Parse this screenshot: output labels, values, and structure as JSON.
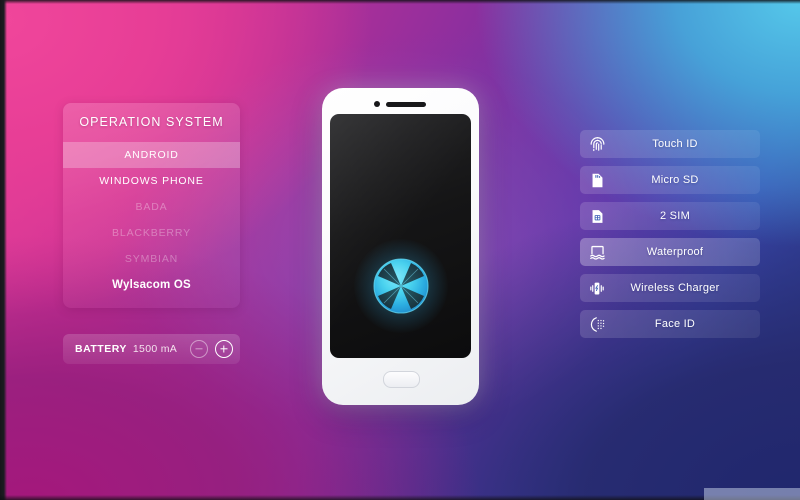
{
  "background": {
    "colors": {
      "pink": "#e8409a",
      "magenta": "#a4187c",
      "cyan": "#55c8ea",
      "navy": "#20276e",
      "purple": "#5b36a8"
    }
  },
  "os_panel": {
    "title": "OPERATION SYSTEM",
    "items": [
      {
        "label": "ANDROID",
        "state": "selected"
      },
      {
        "label": "WINDOWS PHONE",
        "state": "normal"
      },
      {
        "label": "BADA",
        "state": "disabled"
      },
      {
        "label": "BLACKBERRY",
        "state": "disabled"
      },
      {
        "label": "SYMBIAN",
        "state": "disabled"
      },
      {
        "label": "Wylsacom OS",
        "state": "brand"
      }
    ]
  },
  "battery": {
    "label": "BATTERY",
    "value": "1500 mA",
    "decrement_icon": "minus-icon",
    "increment_icon": "plus-icon"
  },
  "phone": {
    "camera_icon": "camera-dot-icon",
    "speaker_icon": "earpiece-speaker-icon",
    "home_button_icon": "home-button-icon",
    "logo_icon": "wylsacom-logo-icon",
    "logo_color": "#4fd8f0"
  },
  "features": [
    {
      "label": "Touch ID",
      "icon": "fingerprint-icon",
      "state": "normal"
    },
    {
      "label": "Micro SD",
      "icon": "sd-card-icon",
      "state": "normal"
    },
    {
      "label": "2 SIM",
      "icon": "sim-card-icon",
      "state": "normal"
    },
    {
      "label": "Waterproof",
      "icon": "waterproof-icon",
      "state": "highlight"
    },
    {
      "label": "Wireless Charger",
      "icon": "wireless-charger-icon",
      "state": "normal"
    },
    {
      "label": "Face ID",
      "icon": "face-id-icon",
      "state": "normal"
    }
  ]
}
